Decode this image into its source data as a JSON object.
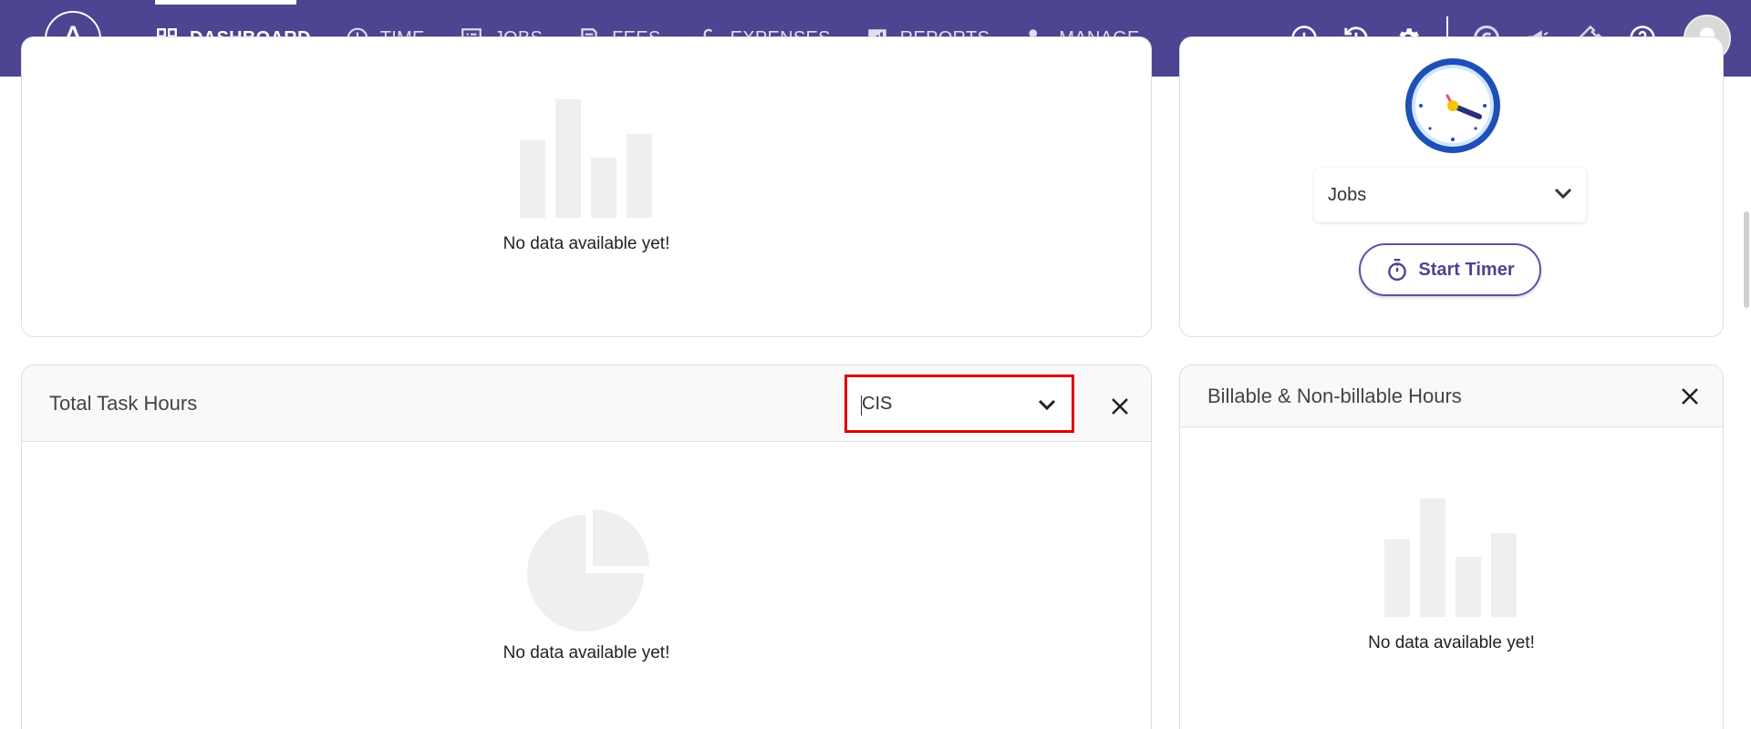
{
  "nav": {
    "logo_letter": "A",
    "items": [
      {
        "label": "DASHBOARD",
        "icon": "dashboard-grid-icon",
        "active": true
      },
      {
        "label": "TIME",
        "icon": "clock-icon"
      },
      {
        "label": "JOBS",
        "icon": "list-icon"
      },
      {
        "label": "FEES",
        "icon": "receipt-icon"
      },
      {
        "label": "EXPENSES",
        "icon": "pound-icon"
      },
      {
        "label": "REPORTS",
        "icon": "bar-report-icon"
      },
      {
        "label": "MANAGE",
        "icon": "user-gear-icon"
      }
    ],
    "right_icons": [
      "add-circle-icon",
      "history-icon",
      "gear-icon",
      "c-logo-icon",
      "megaphone-icon",
      "ticket-icon",
      "help-icon",
      "avatar-icon"
    ]
  },
  "top_left_card": {
    "empty_text": "No data available yet!"
  },
  "timer_card": {
    "select_value": "Jobs",
    "button_label": "Start Timer"
  },
  "task_hours_card": {
    "title": "Total Task Hours",
    "filter_value": "CIS",
    "empty_text": "No data available yet!"
  },
  "billable_card": {
    "title": "Billable & Non-billable Hours",
    "empty_text": "No data available yet!"
  },
  "colors": {
    "nav_bg": "#4b4592",
    "accent": "#5a52a8",
    "highlight": "#e00000",
    "placeholder": "#efefef"
  }
}
